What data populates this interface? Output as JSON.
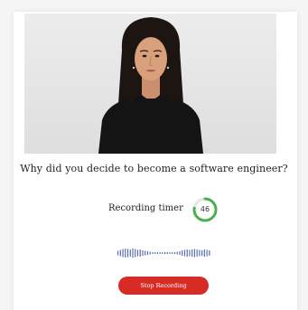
{
  "question": {
    "text": "Why did you decide to become a software engineer?"
  },
  "timer": {
    "label": "Recording timer",
    "value": "46",
    "progress_fraction": 0.77,
    "ring_color": "#4caf50",
    "track_color": "#e6e6e6"
  },
  "actions": {
    "stop_label": "Stop Recording",
    "stop_color": "#d62c25"
  },
  "waveform": {
    "icon": "audio-waveform-icon",
    "color": "#5a6fb0"
  },
  "video": {
    "icon": "presenter-video-feed"
  }
}
